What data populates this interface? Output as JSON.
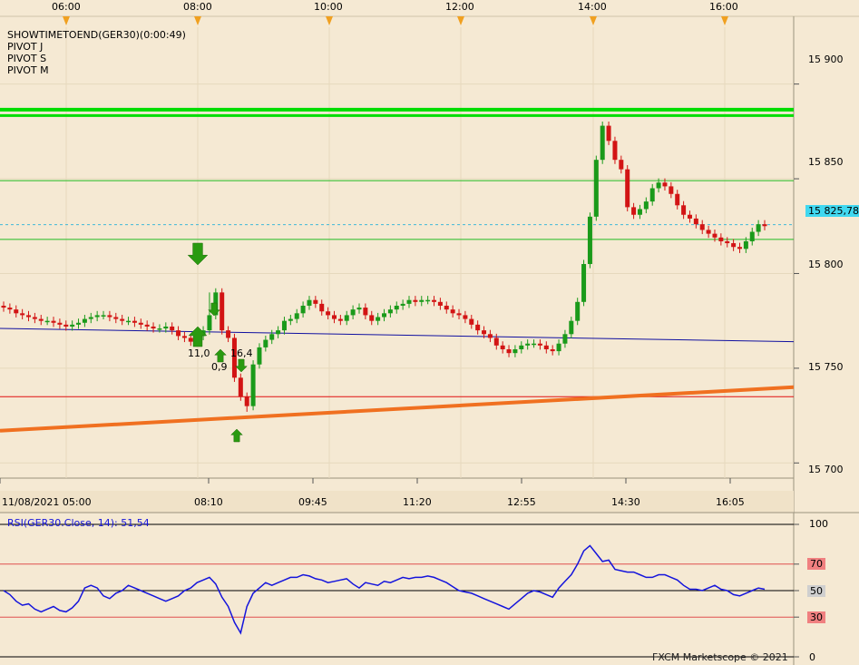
{
  "header": {
    "time_ticks": [
      "06:00",
      "08:00",
      "10:00",
      "12:00",
      "14:00",
      "16:00"
    ]
  },
  "indicators": [
    "SHOWTIMETOEND(GER30)(0:00:49)",
    "PIVOT J",
    "PIVOT S",
    "PIVOT M"
  ],
  "price_axis": {
    "ticks": [
      "15 900",
      "15 850",
      "15 800",
      "15 750",
      "15 700"
    ],
    "current_price": "15 825,78"
  },
  "time_axis": {
    "labels": [
      "11/08/2021 05:00",
      "08:10",
      "09:45",
      "11:20",
      "12:55",
      "14:30",
      "16:05"
    ]
  },
  "annotations": {
    "signal_labels": [
      "11,0",
      "0,9",
      "16,4"
    ]
  },
  "rsi": {
    "label": "RSI(GER30.Close, 14): 51,54",
    "ticks": [
      "100",
      "70",
      "50",
      "30",
      "0"
    ]
  },
  "footer": {
    "credit": "FXCM Marketscope © 2021"
  },
  "colors": {
    "background": "#f5e9d3",
    "bull_candle": "#1a9a1a",
    "bear_candle": "#d21414",
    "pivot_line": "#00dd00",
    "support_line": "#e01010",
    "trend_line": "#f07020",
    "moving_average": "#1010a0",
    "rsi_line": "#1414dc",
    "signal_arrow": "#2a9a10",
    "time_marker": "#f0a020"
  },
  "chart_data": [
    {
      "type": "candlestick",
      "title": "",
      "ylim": [
        15692,
        15930
      ],
      "y_ticks": [
        15700,
        15750,
        15800,
        15850,
        15900
      ],
      "horizontal_lines": [
        {
          "name": "PIVOT J",
          "value": 15886,
          "style": "thick"
        },
        {
          "name": "PIVOT S",
          "value": 15849,
          "style": "thin"
        },
        {
          "name": "PIVOT M",
          "value": 15818,
          "style": "thin"
        },
        {
          "name": "current",
          "value": 15825.78,
          "style": "dashed"
        },
        {
          "name": "support",
          "value": 15735,
          "style": "thin"
        }
      ],
      "trend_lines": [
        {
          "name": "orange",
          "start": 15717,
          "end": 15740
        },
        {
          "name": "moving-average",
          "start": 15771,
          "end": 15764
        }
      ],
      "closes": [
        15782,
        15781,
        15779,
        15778,
        15777,
        15776,
        15775,
        15775,
        15774,
        15773,
        15772,
        15773,
        15774,
        15776,
        15777,
        15778,
        15778,
        15777,
        15776,
        15775,
        15775,
        15774,
        15773,
        15772,
        15771,
        15771,
        15772,
        15770,
        15767,
        15766,
        15764,
        15767,
        15770,
        15778,
        15790,
        15770,
        15766,
        15745,
        15735,
        15730,
        15752,
        15761,
        15765,
        15768,
        15770,
        15775,
        15776,
        15779,
        15783,
        15786,
        15784,
        15780,
        15778,
        15776,
        15775,
        15778,
        15781,
        15782,
        15778,
        15775,
        15777,
        15779,
        15781,
        15783,
        15784,
        15786,
        15785,
        15786,
        15786,
        15785,
        15783,
        15781,
        15779,
        15778,
        15776,
        15773,
        15770,
        15768,
        15766,
        15762,
        15760,
        15758,
        15760,
        15762,
        15763,
        15763,
        15762,
        15760,
        15759,
        15763,
        15768,
        15775,
        15785,
        15805,
        15830,
        15860,
        15878,
        15870,
        15860,
        15855,
        15835,
        15831,
        15834,
        15838,
        15845,
        15848,
        15846,
        15842,
        15836,
        15831,
        15829,
        15826,
        15823,
        15821,
        15819,
        15817,
        15816,
        15814,
        15813,
        15817,
        15822,
        15826,
        15825
      ],
      "signals": [
        {
          "kind": "sell",
          "label": ""
        },
        {
          "kind": "buy",
          "label": "11,0"
        },
        {
          "kind": "buy",
          "label": "0,9"
        },
        {
          "kind": "sell",
          "label": ""
        },
        {
          "kind": "sell",
          "label": "16,4"
        },
        {
          "kind": "buy",
          "label": ""
        }
      ]
    },
    {
      "type": "line",
      "title": "RSI(GER30.Close, 14): 51,54",
      "ylim": [
        0,
        100
      ],
      "levels": [
        100,
        70,
        50,
        30,
        0
      ],
      "values": [
        50,
        47,
        42,
        39,
        40,
        36,
        34,
        36,
        38,
        35,
        34,
        37,
        42,
        52,
        54,
        52,
        46,
        44,
        48,
        50,
        54,
        52,
        50,
        48,
        46,
        44,
        42,
        44,
        46,
        50,
        52,
        56,
        58,
        60,
        55,
        45,
        38,
        26,
        18,
        38,
        48,
        52,
        56,
        54,
        56,
        58,
        60,
        60,
        62,
        61,
        59,
        58,
        56,
        57,
        58,
        59,
        55,
        52,
        56,
        55,
        54,
        57,
        56,
        58,
        60,
        59,
        60,
        60,
        61,
        60,
        58,
        56,
        53,
        50,
        49,
        48,
        46,
        44,
        42,
        40,
        38,
        36,
        40,
        44,
        48,
        50,
        49,
        47,
        45,
        52,
        57,
        62,
        70,
        80,
        84,
        78,
        72,
        73,
        66,
        65,
        64,
        64,
        62,
        60,
        60,
        62,
        62,
        60,
        58,
        54,
        51,
        51,
        50,
        52,
        54,
        51,
        50,
        47,
        46,
        48,
        50,
        52,
        51
      ]
    }
  ]
}
